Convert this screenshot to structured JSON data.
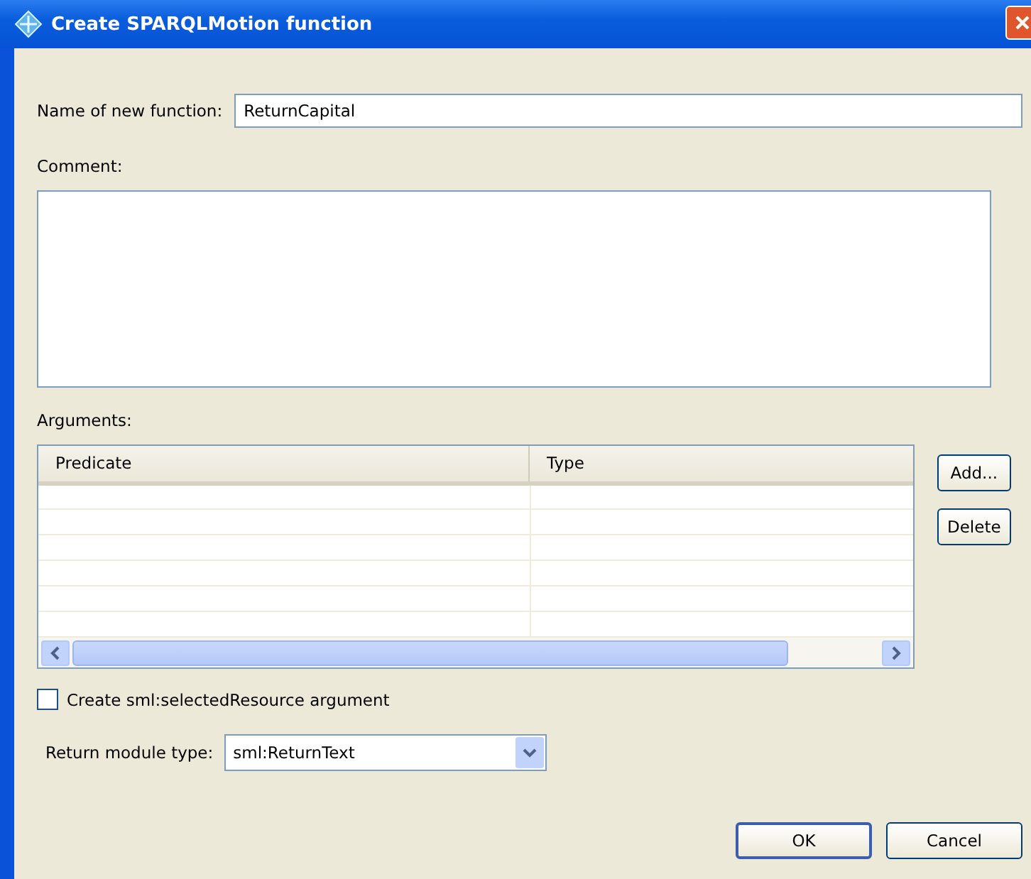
{
  "window": {
    "title": "Create SPARQLMotion function"
  },
  "name_field": {
    "label": "Name of new function:",
    "value": "ReturnCapital"
  },
  "comment": {
    "label": "Comment:"
  },
  "arguments": {
    "label": "Arguments:",
    "columns": [
      "Predicate",
      "Type"
    ],
    "buttons": [
      "Add...",
      "Delete"
    ]
  },
  "selected_resource": {
    "label": "Create sml:selectedResource argument",
    "checked": false
  },
  "return_type": {
    "label": "Return module type:",
    "value": "sml:ReturnText"
  },
  "buttons": [
    {
      "label": "OK",
      "default": true
    },
    {
      "label": "Cancel",
      "default": false
    }
  ]
}
